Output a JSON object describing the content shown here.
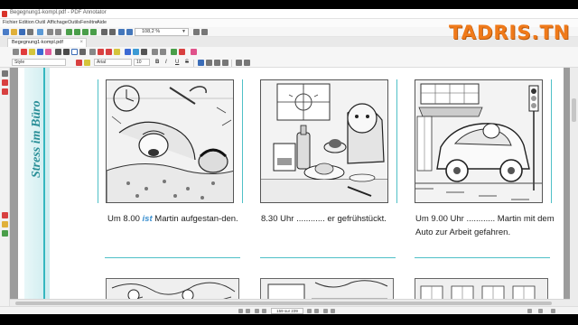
{
  "window": {
    "title": "Begegnung1-kompl.pdf - PDF Annotator",
    "zoom": "108,2 %",
    "tab_label": "Begegnung1-kompl.pdf",
    "tab_close": "×"
  },
  "overlay": {
    "logo": "TADRIS.TN"
  },
  "menu": [
    "Fichier",
    "Edition",
    "Outil",
    "Affichage",
    "Outils",
    "Fenêtre",
    "Aide"
  ],
  "format_bar": {
    "style_label": "Style",
    "font_name": "Arial",
    "font_size": "10",
    "bold": "B",
    "italic": "I",
    "underline": "U",
    "strike": "S"
  },
  "document": {
    "side_title": "Stress im Büro",
    "captions": [
      {
        "pre": "Um 8.00 ",
        "verb": "ist",
        "post": " Martin aufgestan-den."
      },
      {
        "text": "8.30 Uhr ............ er gefrühstückt."
      },
      {
        "text": "Um 9.00 Uhr ............ Martin mit dem Auto zur Arbeit gefahren."
      }
    ]
  },
  "status": {
    "page_display": "159 sur 239"
  },
  "colors": {
    "accent_teal": "#2a8f98",
    "logo_orange": "#f07a1a",
    "verb_blue": "#3a8fd0"
  }
}
